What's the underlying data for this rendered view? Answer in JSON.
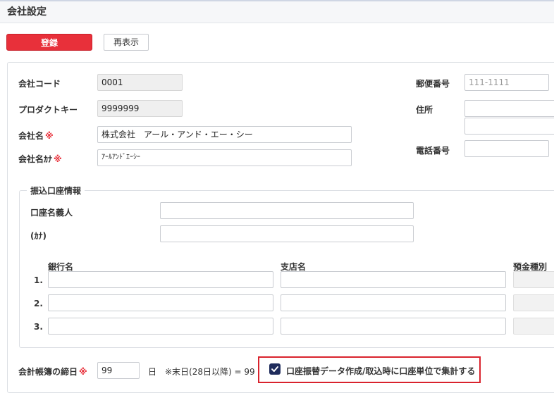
{
  "page": {
    "title": "会社設定"
  },
  "toolbar": {
    "register_label": "登録",
    "redisplay_label": "再表示"
  },
  "company": {
    "code_label": "会社コード",
    "code_value": "0001",
    "product_key_label": "プロダクトキー",
    "product_key_value": "9999999",
    "name_label": "会社名",
    "name_value": "株式会社　アール・アンド・エー・シー",
    "name_kana_label": "会社名ｶﾅ",
    "name_kana_value": "ｱｰﾙｱﾝﾄﾞｴｰｼｰ",
    "required_mark": "※",
    "postal_label": "郵便番号",
    "postal_placeholder": "111-1111",
    "address_label": "住所",
    "phone_label": "電話番号"
  },
  "transfer": {
    "legend": "振込口座情報",
    "holder_label": "口座名義人",
    "kana_label": "(ｶﾅ)",
    "headers": {
      "bank": "銀行名",
      "branch": "支店名",
      "type": "預金種別"
    },
    "rows": [
      "1.",
      "2.",
      "3."
    ]
  },
  "closing": {
    "label": "会計帳簿の締日",
    "required_mark": "※",
    "value": "99",
    "unit": "日",
    "note": "※末日(28日以降) = 99",
    "checkbox_label": "口座振替データ作成/取込時に口座単位で集計する",
    "checkbox_checked": true
  },
  "colors": {
    "accent": "#e8303a",
    "checkbox": "#1f2c5c",
    "highlight": "#d9232d"
  }
}
